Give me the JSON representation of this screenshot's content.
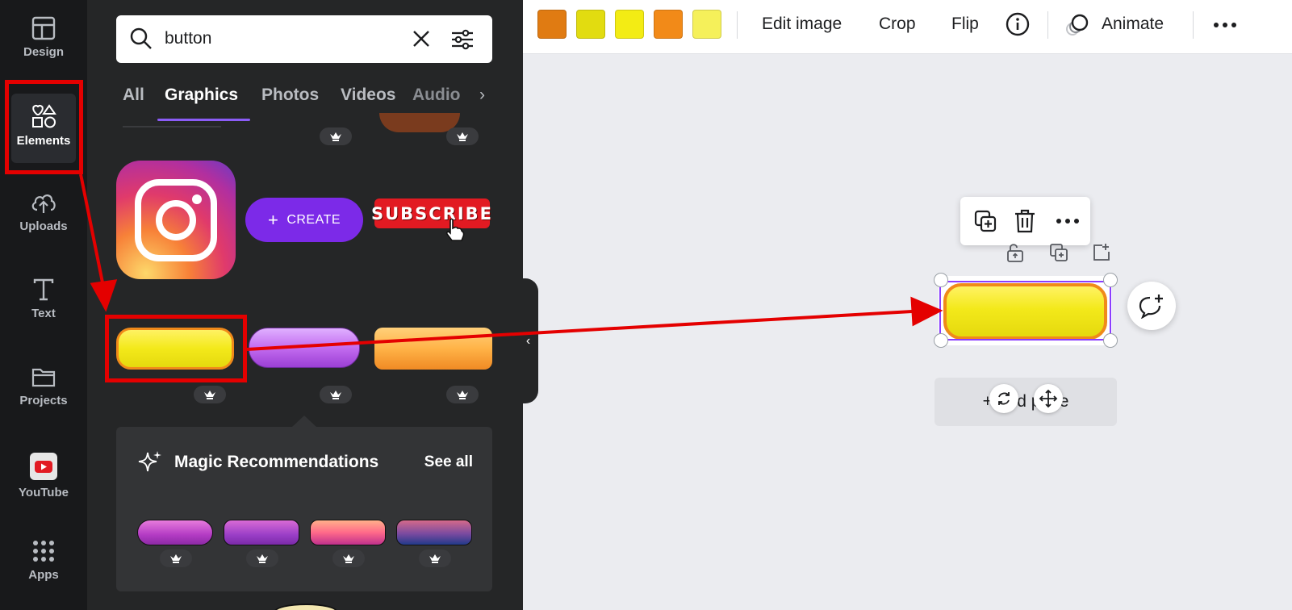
{
  "rail": {
    "items": [
      {
        "label": "Design",
        "icon": "layout-icon"
      },
      {
        "label": "Elements",
        "icon": "shapes-icon",
        "active": true
      },
      {
        "label": "Uploads",
        "icon": "cloud-upload-icon"
      },
      {
        "label": "Text",
        "icon": "text-icon"
      },
      {
        "label": "Projects",
        "icon": "folder-icon"
      },
      {
        "label": "YouTube",
        "icon": "youtube-icon"
      },
      {
        "label": "Apps",
        "icon": "apps-grid-icon"
      }
    ]
  },
  "search": {
    "value": "button"
  },
  "tabs": [
    "All",
    "Graphics",
    "Photos",
    "Videos",
    "Audio"
  ],
  "active_tab": "Graphics",
  "results": {
    "create_label": "CREATE",
    "subscribe_label": "SUBSCRIBE"
  },
  "magic": {
    "title": "Magic Recommendations",
    "see_all": "See all"
  },
  "toolbar": {
    "swatches": [
      "#e07b12",
      "#e2dc10",
      "#f3ec14",
      "#f28a18",
      "#f5f05a"
    ],
    "edit_image": "Edit image",
    "crop": "Crop",
    "flip": "Flip",
    "animate": "Animate"
  },
  "canvas": {
    "add_page": "+ Add page"
  },
  "colors": {
    "accent": "#8b3dff",
    "highlight": "#e40000"
  }
}
